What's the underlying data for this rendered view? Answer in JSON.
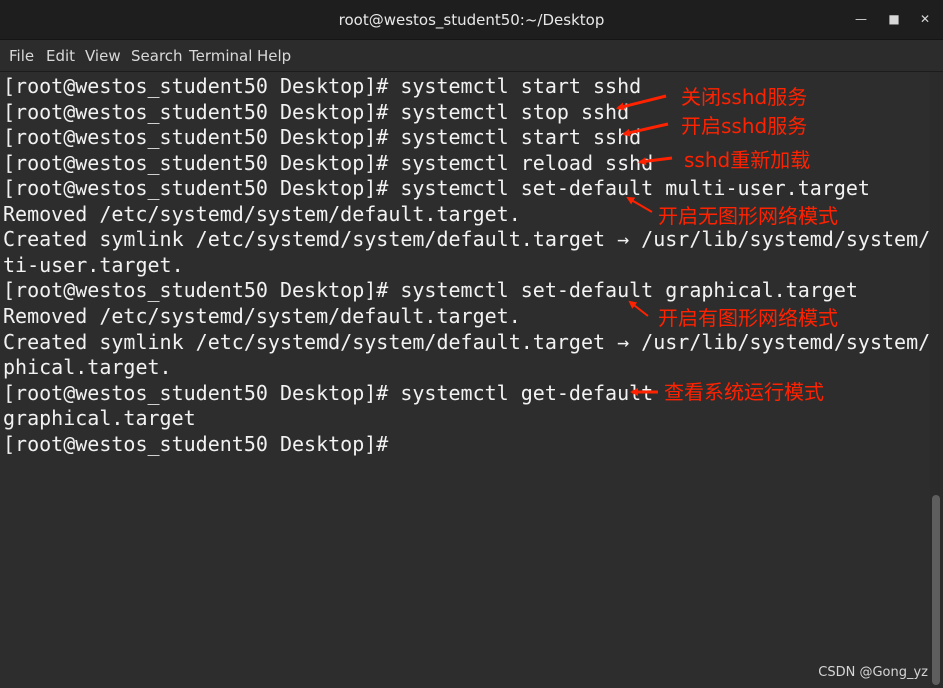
{
  "window": {
    "title": "root@westos_student50:~/Desktop"
  },
  "menu": [
    "File",
    "Edit",
    "View",
    "Search",
    "Terminal",
    "Help"
  ],
  "terminal": {
    "lines": [
      "[root@westos_student50 Desktop]# systemctl start sshd",
      "[root@westos_student50 Desktop]# systemctl stop sshd",
      "[root@westos_student50 Desktop]# systemctl start sshd",
      "[root@westos_student50 Desktop]# systemctl reload sshd",
      "[root@westos_student50 Desktop]# systemctl set-default multi-user.target",
      "Removed /etc/systemd/system/default.target.",
      "Created symlink /etc/systemd/system/default.target → /usr/lib/systemd/system/mul",
      "ti-user.target.",
      "[root@westos_student50 Desktop]# systemctl set-default graphical.target",
      "Removed /etc/systemd/system/default.target.",
      "Created symlink /etc/systemd/system/default.target → /usr/lib/systemd/system/gra",
      "phical.target.",
      "[root@westos_student50 Desktop]# systemctl get-default",
      "graphical.target",
      "[root@westos_student50 Desktop]# "
    ]
  },
  "annotations": [
    "关闭sshd服务",
    "开启sshd服务",
    "sshd重新加载",
    "开启无图形网络模式",
    "开启有图形网络模式",
    "查看系统运行模式"
  ],
  "watermark": "CSDN @Gong_yz",
  "colors": {
    "annotation": "#ff2200",
    "terminal_bg": "#2d2d2d",
    "titlebar_bg": "#1e1e1e"
  }
}
